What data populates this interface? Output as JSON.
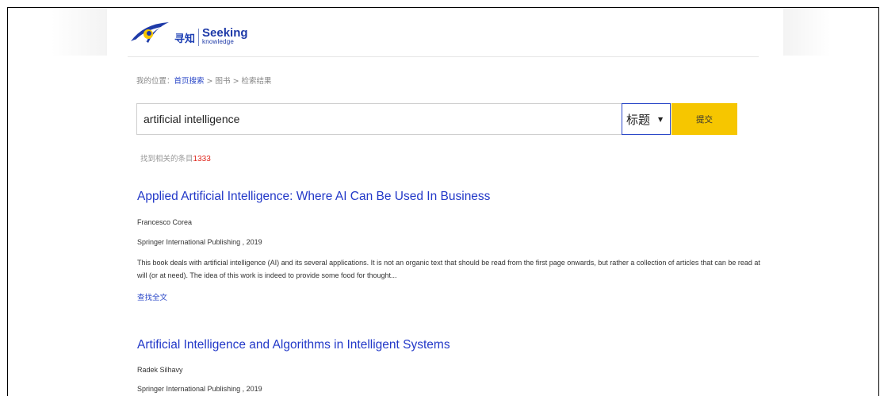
{
  "logo": {
    "cn_text": "寻知",
    "en_text_top": "Seeking",
    "en_text_bottom": "knowledge",
    "brand_blue": "#1e3aa8",
    "brand_yellow": "#f6c600"
  },
  "breadcrumb": {
    "prefix": "我的位置：",
    "home_link": "首页搜索",
    "sep1": " > ",
    "level2": "图书",
    "sep2": " > ",
    "current": "检索结果"
  },
  "search": {
    "query": "artificial intelligence",
    "field_selected": "标题",
    "field_arrow": "▼",
    "submit_label": "提交"
  },
  "summary": {
    "label": "找到相关的条目",
    "count": "1333"
  },
  "results": [
    {
      "title": "Applied Artificial Intelligence: Where AI Can Be Used In Business",
      "author": "Francesco Corea",
      "publisher": "Springer International Publishing , 2019",
      "abstract": "This book deals with artificial intelligence (AI) and its several applications. It is not an organic text that should be read from the first page onwards, but rather a collection of articles that can be read at will (or at need). The idea of this work is indeed to provide some food for thought...",
      "link_label": "查找全文"
    },
    {
      "title": "Artificial Intelligence and Algorithms in Intelligent Systems",
      "author": "Radek Silhavy",
      "publisher": "Springer International Publishing , 2019"
    }
  ]
}
